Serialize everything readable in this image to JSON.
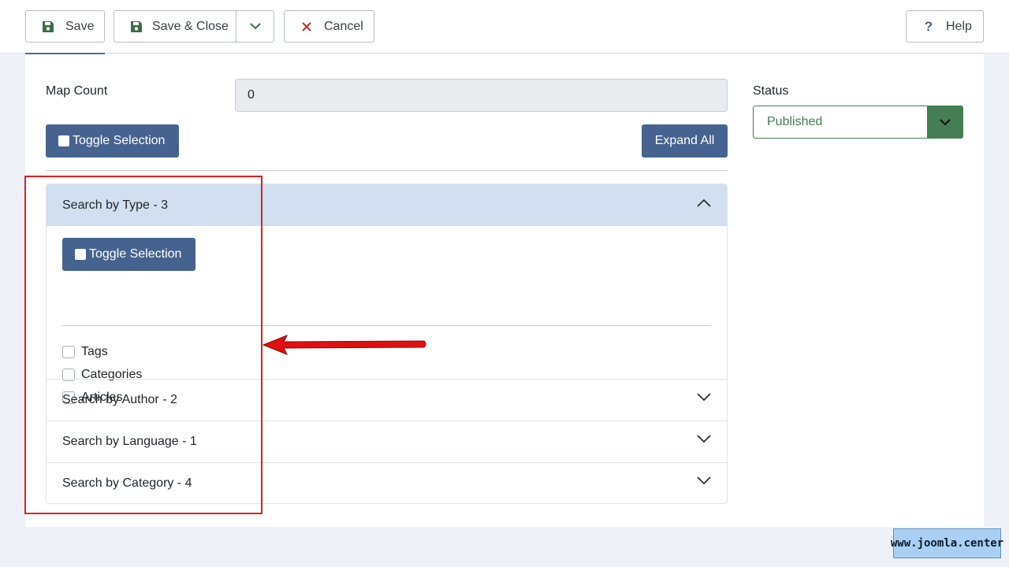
{
  "toolbar": {
    "save_label": "Save",
    "save_close_label": "Save & Close",
    "cancel_label": "Cancel",
    "help_label": "Help"
  },
  "form": {
    "map_count_label": "Map Count",
    "map_count_value": "0",
    "toggle_selection_label": "Toggle Selection",
    "expand_all_label": "Expand All",
    "status_label": "Status",
    "status_value": "Published"
  },
  "accordion": {
    "sections": [
      {
        "title": "Search by Type - 3",
        "expanded": true,
        "toggle_label": "Toggle Selection",
        "options": [
          "Tags",
          "Categories",
          "Articles"
        ]
      },
      {
        "title": "Search by Author - 2",
        "expanded": false
      },
      {
        "title": "Search by Language - 1",
        "expanded": false
      },
      {
        "title": "Search by Category - 4",
        "expanded": false
      }
    ]
  },
  "watermark": "www.joomla.center",
  "colors": {
    "primary_blue": "#46638f",
    "status_green": "#457d54",
    "accordion_active": "#d1dff0",
    "annotation_red": "#e02020",
    "cancel_red": "#c52827"
  }
}
